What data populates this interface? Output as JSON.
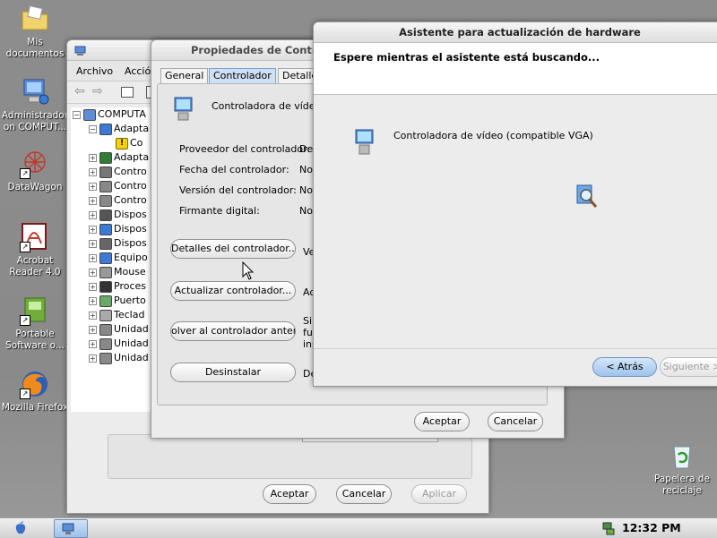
{
  "desktop": {
    "icons": [
      {
        "label": "Mis documentos"
      },
      {
        "label": "Administrador on COMPUT..."
      },
      {
        "label": "DataWagon"
      },
      {
        "label": "Acrobat Reader 4.0"
      },
      {
        "label": "Portable Software o..."
      },
      {
        "label": "Mozilla Firefox"
      },
      {
        "label": "Papelera de reciclaje"
      }
    ]
  },
  "devmgr": {
    "menu": [
      "Archivo",
      "Acció"
    ],
    "tree": [
      {
        "label": "COMPUTA"
      },
      {
        "label": "Adapta"
      },
      {
        "label": "Co"
      },
      {
        "label": "Adapta"
      },
      {
        "label": "Contro"
      },
      {
        "label": "Contro"
      },
      {
        "label": "Contro"
      },
      {
        "label": "Dispos"
      },
      {
        "label": "Dispos"
      },
      {
        "label": "Dispos"
      },
      {
        "label": "Equipo"
      },
      {
        "label": "Mouse"
      },
      {
        "label": "Proces"
      },
      {
        "label": "Puerto"
      },
      {
        "label": "Teclad"
      },
      {
        "label": "Unidad"
      },
      {
        "label": "Unidad"
      },
      {
        "label": "Unidad"
      }
    ],
    "ok": "Aceptar",
    "cancel": "Cancelar",
    "apply": "Aplicar"
  },
  "props": {
    "title": "Propiedades de Controla",
    "tabs": [
      "General",
      "Controlador",
      "Detalle"
    ],
    "device": "Controladora de vídeo (",
    "fields": [
      {
        "label": "Proveedor del controlador:",
        "value": "De"
      },
      {
        "label": "Fecha del controlador:",
        "value": "No"
      },
      {
        "label": "Versión del controlador:",
        "value": "No"
      },
      {
        "label": "Firmante digital:",
        "value": "No"
      }
    ],
    "buttons": [
      {
        "label": "Detalles del controlador...",
        "desc": "Ve"
      },
      {
        "label": "Actualizar controlador...",
        "desc": "Ac"
      },
      {
        "label": "olver al controlador anteric",
        "desc": "Si fu ins"
      },
      {
        "label": "Desinstalar",
        "desc": "De"
      }
    ],
    "ok": "Aceptar",
    "cancel": "Cancelar"
  },
  "wizard": {
    "title": "Asistente para actualización de hardware",
    "heading": "Espere mientras el asistente está buscando...",
    "device": "Controladora de vídeo (compatible VGA)",
    "back": "< Atrás",
    "next": "Siguiente >"
  },
  "taskbar": {
    "time": "12:32 PM"
  }
}
